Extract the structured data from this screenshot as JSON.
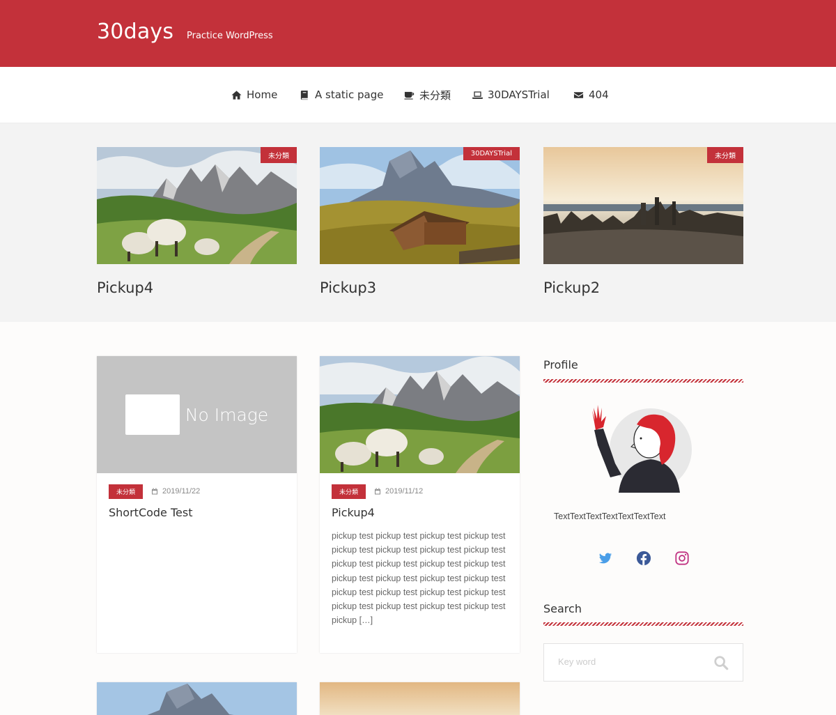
{
  "header": {
    "site_title": "30days",
    "tagline": "Practice WordPress"
  },
  "nav": [
    {
      "label": "Home",
      "icon": "home-icon"
    },
    {
      "label": "A static page",
      "icon": "book-icon"
    },
    {
      "label": "未分類",
      "icon": "coffee-icon"
    },
    {
      "label": "30DAYSTrial",
      "icon": "laptop-icon"
    },
    {
      "label": "404",
      "icon": "envelope-icon"
    }
  ],
  "pickups": [
    {
      "title": "Pickup4",
      "category": "未分類"
    },
    {
      "title": "Pickup3",
      "category": "30DAYSTrial"
    },
    {
      "title": "Pickup2",
      "category": "未分類"
    }
  ],
  "posts": [
    {
      "title": "ShortCode Test",
      "category": "未分類",
      "date": "2019/11/22",
      "thumb_label": "No Image"
    },
    {
      "title": "Pickup4",
      "category": "未分類",
      "date": "2019/11/12",
      "excerpt": "pickup test pickup test pickup test pickup test pickup test pickup test pickup test pickup test pickup test pickup test pickup test pickup test pickup test pickup test pickup test pickup test pickup test pickup test pickup test pickup test pickup test pickup test pickup test pickup test pickup […]"
    }
  ],
  "sidebar": {
    "profile_title": "Profile",
    "profile_text": "TextTextTextTextTextTextText",
    "social": [
      "twitter-icon",
      "facebook-icon",
      "instagram-icon"
    ],
    "search_title": "Search",
    "search_placeholder": "Key word"
  },
  "colors": {
    "brand": "#c3313a",
    "twitter": "#4a9ee8",
    "facebook": "#3b5998",
    "instagram": "#c13584"
  }
}
